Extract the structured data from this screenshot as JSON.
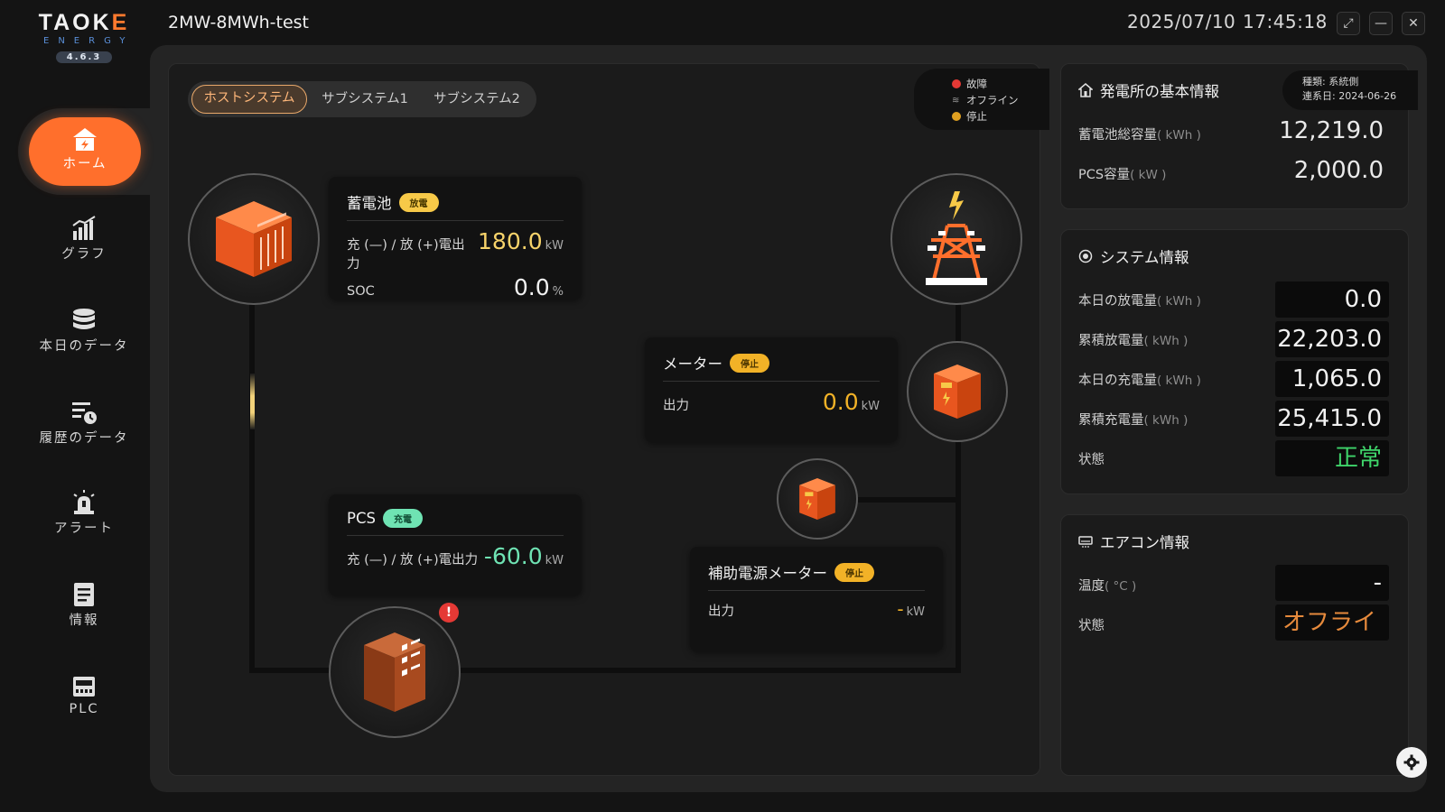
{
  "logo": {
    "word_pre": "TAO",
    "word_k": "K",
    "word_ring": "E",
    "sub": "ENERGY",
    "version": "4.6.3"
  },
  "header": {
    "title": "2MW-8MWh-test",
    "date": "2025/07/10",
    "time": "17:45:18",
    "buttons": {
      "expand": "⤢",
      "minimize": "—",
      "close": "✕"
    }
  },
  "sidebar": {
    "items": [
      {
        "label": "ホーム",
        "icon": "home-icon",
        "active": true
      },
      {
        "label": "グラフ",
        "icon": "chart-icon"
      },
      {
        "label": "本日のデータ",
        "icon": "database-icon"
      },
      {
        "label": "履歴のデータ",
        "icon": "history-icon"
      },
      {
        "label": "アラート",
        "icon": "alarm-icon"
      },
      {
        "label": "情報",
        "icon": "document-icon"
      },
      {
        "label": "PLC",
        "icon": "plc-icon"
      }
    ]
  },
  "tabs": [
    "ホストシステム",
    "サブシステム1",
    "サブシステム2"
  ],
  "legend": {
    "fault": "故障",
    "offline": "オフライン",
    "stopped": "停止",
    "colors": {
      "fault": "#e53935",
      "offline": "#8a8a8a",
      "stopped": "#e0a020"
    }
  },
  "battery_card": {
    "title": "蓄電池",
    "badge": "放電",
    "power_label": "充 (—) / 放 (+)電出力",
    "power_value": "180.0",
    "power_unit": "kW",
    "soc_label": "SOC",
    "soc_value": "0.0",
    "soc_unit": "%"
  },
  "pcs_card": {
    "title": "PCS",
    "badge": "充電",
    "power_label": "充 (—) / 放 (+)電出力",
    "power_value": "-60.0",
    "power_unit": "kW"
  },
  "meter_card": {
    "title": "メーター",
    "badge": "停止",
    "output_label": "出力",
    "output_value": "0.0",
    "output_unit": "kW"
  },
  "aux_meter_card": {
    "title": "補助電源メーター",
    "badge": "停止",
    "output_label": "出力",
    "output_value": "-",
    "output_unit": "kW"
  },
  "pcs_alert": "!",
  "station_info": {
    "title": "発電所の基本情報",
    "type_line": "種類: 系統側",
    "date_line": "連系日: 2024-06-26",
    "rows": [
      {
        "label": "蓄電池総容量",
        "unit": "( kWh )",
        "value": "12,219.0"
      },
      {
        "label": "PCS容量",
        "unit": "( kW )",
        "value": "2,000.0"
      }
    ]
  },
  "system_info": {
    "title": "システム情報",
    "rows": [
      {
        "label": "本日の放電量",
        "unit": "( kWh )",
        "value": "0.0"
      },
      {
        "label": "累積放電量",
        "unit": "( kWh )",
        "value": "22,203.0"
      },
      {
        "label": "本日の充電量",
        "unit": "( kWh )",
        "value": "1,065.0"
      },
      {
        "label": "累積充電量",
        "unit": "( kWh )",
        "value": "25,415.0"
      }
    ],
    "status_label": "状態",
    "status_value": "正常"
  },
  "aircon_info": {
    "title": "エアコン情報",
    "temp_label": "温度",
    "temp_unit": "( °C )",
    "temp_value": "-",
    "status_label": "状態",
    "status_value": "オフライ"
  },
  "colors": {
    "accent": "#ff6f2c",
    "discharge_yellow": "#f7d36a",
    "charge_green": "#6fe3b3",
    "meter_amber": "#f2b227",
    "status_green": "#3fd46a",
    "offline_orange": "#e68a3c"
  }
}
